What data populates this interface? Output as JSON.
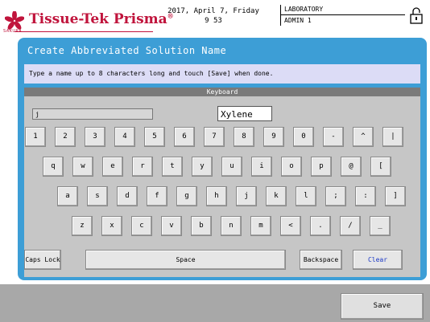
{
  "header": {
    "brand_name": "Tissue-Tek Prisma",
    "brand_mark": "®",
    "brand_sub": "SAKURA",
    "date_line": "2017, April 7, Friday",
    "time_line": "9 53",
    "location": "LABORATORY",
    "user": "ADMIN 1",
    "lock_icon": "lock-icon"
  },
  "dialog": {
    "title": "Create Abbreviated Solution Name",
    "instruction": "Type a name up to 8 characters long and touch [Save] when done.",
    "keyboard_title": "Keyboard",
    "left_field_value": "j",
    "name_field_value": "Xylene"
  },
  "keyboard": {
    "row1": [
      "1",
      "2",
      "3",
      "4",
      "5",
      "6",
      "7",
      "8",
      "9",
      "0",
      "-",
      "^",
      "|"
    ],
    "row2": [
      "q",
      "w",
      "e",
      "r",
      "t",
      "y",
      "u",
      "i",
      "o",
      "p",
      "@",
      "["
    ],
    "row3": [
      "a",
      "s",
      "d",
      "f",
      "g",
      "h",
      "j",
      "k",
      "l",
      ";",
      ":",
      "]"
    ],
    "row4": [
      "z",
      "x",
      "c",
      "v",
      "b",
      "n",
      "m",
      "<",
      ".",
      "/",
      "_"
    ],
    "caps_lock": "Caps Lock",
    "space": "Space",
    "backspace": "Backspace",
    "clear": "Clear"
  },
  "footer": {
    "save_label": "Save"
  },
  "colors": {
    "brand_red": "#c0143c",
    "dialog_blue": "#3d9ed6",
    "instruction_bg": "#dcdcf6",
    "clear_blue": "#1b38c6"
  }
}
